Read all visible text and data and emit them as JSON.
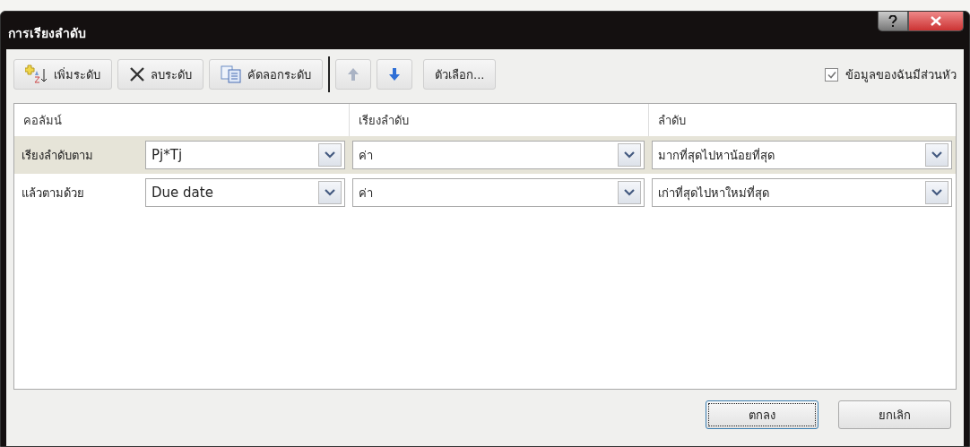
{
  "window": {
    "title": "การเรียงลำดับ"
  },
  "toolbar": [
    {
      "kind": "add",
      "label": "เพิ่มระดับ",
      "disabled": false
    },
    {
      "kind": "delete",
      "label": "ลบระดับ",
      "disabled": false
    },
    {
      "kind": "copy",
      "label": "คัดลอกระดับ",
      "disabled": false
    },
    {
      "kind": "up",
      "disabled": true
    },
    {
      "kind": "down",
      "disabled": false
    },
    {
      "kind": "text",
      "label": "ตัวเลือก...",
      "disabled": false
    }
  ],
  "header_checkbox": {
    "label": "ข้อมูลของฉันมีส่วนหัว",
    "checked": true
  },
  "columns": [
    "คอลัมน์",
    "เรียงลำดับ",
    "ลำดับ"
  ],
  "rows": [
    {
      "label": "เรียงลำดับตาม",
      "column": "Pj*Tj",
      "sort_on": "ค่า",
      "order": "มากที่สุดไปหาน้อยที่สุด",
      "selected": true
    },
    {
      "label": "แล้วตามด้วย",
      "column": "Due date",
      "sort_on": "ค่า",
      "order": "เก่าที่สุดไปหาใหม่ที่สุด",
      "selected": false
    }
  ],
  "buttons": [
    {
      "label": "ตกลง",
      "default": true
    },
    {
      "label": "ยกเลิก",
      "default": false
    }
  ]
}
